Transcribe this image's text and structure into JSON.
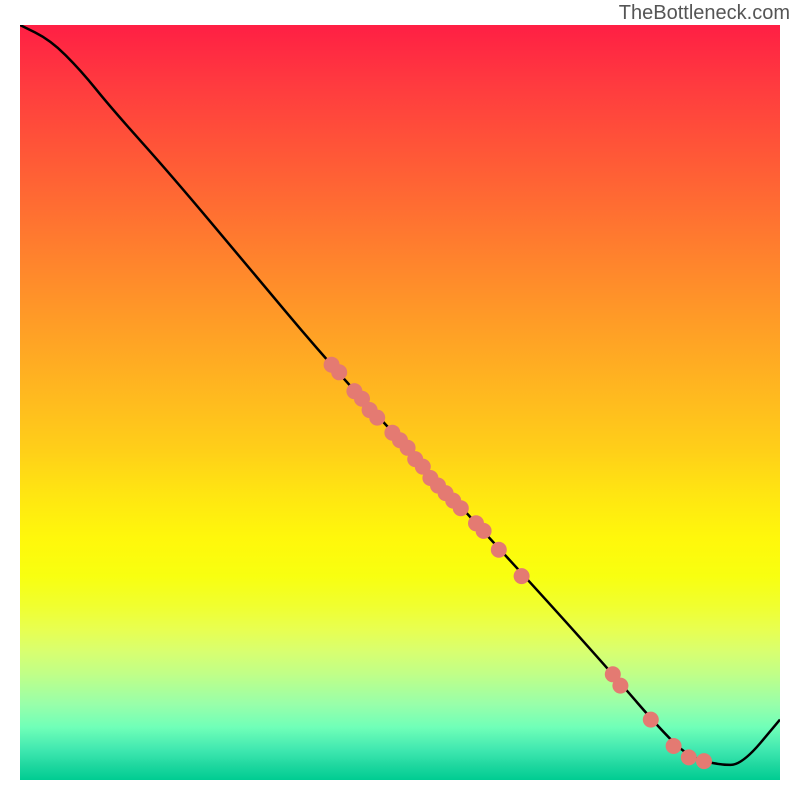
{
  "attribution": "TheBottleneck.com",
  "chart_data": {
    "type": "line",
    "title": "",
    "xlabel": "",
    "ylabel": "",
    "xlim": [
      0,
      100
    ],
    "ylim": [
      0,
      100
    ],
    "curve": [
      {
        "x": 0,
        "y": 100
      },
      {
        "x": 4,
        "y": 98
      },
      {
        "x": 8,
        "y": 94
      },
      {
        "x": 12,
        "y": 89
      },
      {
        "x": 20,
        "y": 80
      },
      {
        "x": 30,
        "y": 68
      },
      {
        "x": 40,
        "y": 56
      },
      {
        "x": 50,
        "y": 45
      },
      {
        "x": 60,
        "y": 34
      },
      {
        "x": 70,
        "y": 23
      },
      {
        "x": 78,
        "y": 14
      },
      {
        "x": 84,
        "y": 7
      },
      {
        "x": 88,
        "y": 3
      },
      {
        "x": 92,
        "y": 2
      },
      {
        "x": 95,
        "y": 2
      },
      {
        "x": 100,
        "y": 8
      }
    ],
    "scatter_points": [
      {
        "x": 41,
        "y": 55
      },
      {
        "x": 42,
        "y": 54
      },
      {
        "x": 44,
        "y": 51.5
      },
      {
        "x": 45,
        "y": 50.5
      },
      {
        "x": 46,
        "y": 49
      },
      {
        "x": 47,
        "y": 48
      },
      {
        "x": 49,
        "y": 46
      },
      {
        "x": 50,
        "y": 45
      },
      {
        "x": 51,
        "y": 44
      },
      {
        "x": 52,
        "y": 42.5
      },
      {
        "x": 53,
        "y": 41.5
      },
      {
        "x": 54,
        "y": 40
      },
      {
        "x": 55,
        "y": 39
      },
      {
        "x": 56,
        "y": 38
      },
      {
        "x": 57,
        "y": 37
      },
      {
        "x": 58,
        "y": 36
      },
      {
        "x": 60,
        "y": 34
      },
      {
        "x": 61,
        "y": 33
      },
      {
        "x": 63,
        "y": 30.5
      },
      {
        "x": 66,
        "y": 27
      },
      {
        "x": 78,
        "y": 14
      },
      {
        "x": 79,
        "y": 12.5
      },
      {
        "x": 83,
        "y": 8
      },
      {
        "x": 86,
        "y": 4.5
      },
      {
        "x": 88,
        "y": 3
      },
      {
        "x": 90,
        "y": 2.5
      }
    ],
    "point_color": "#e47a72",
    "line_color": "#000000"
  }
}
